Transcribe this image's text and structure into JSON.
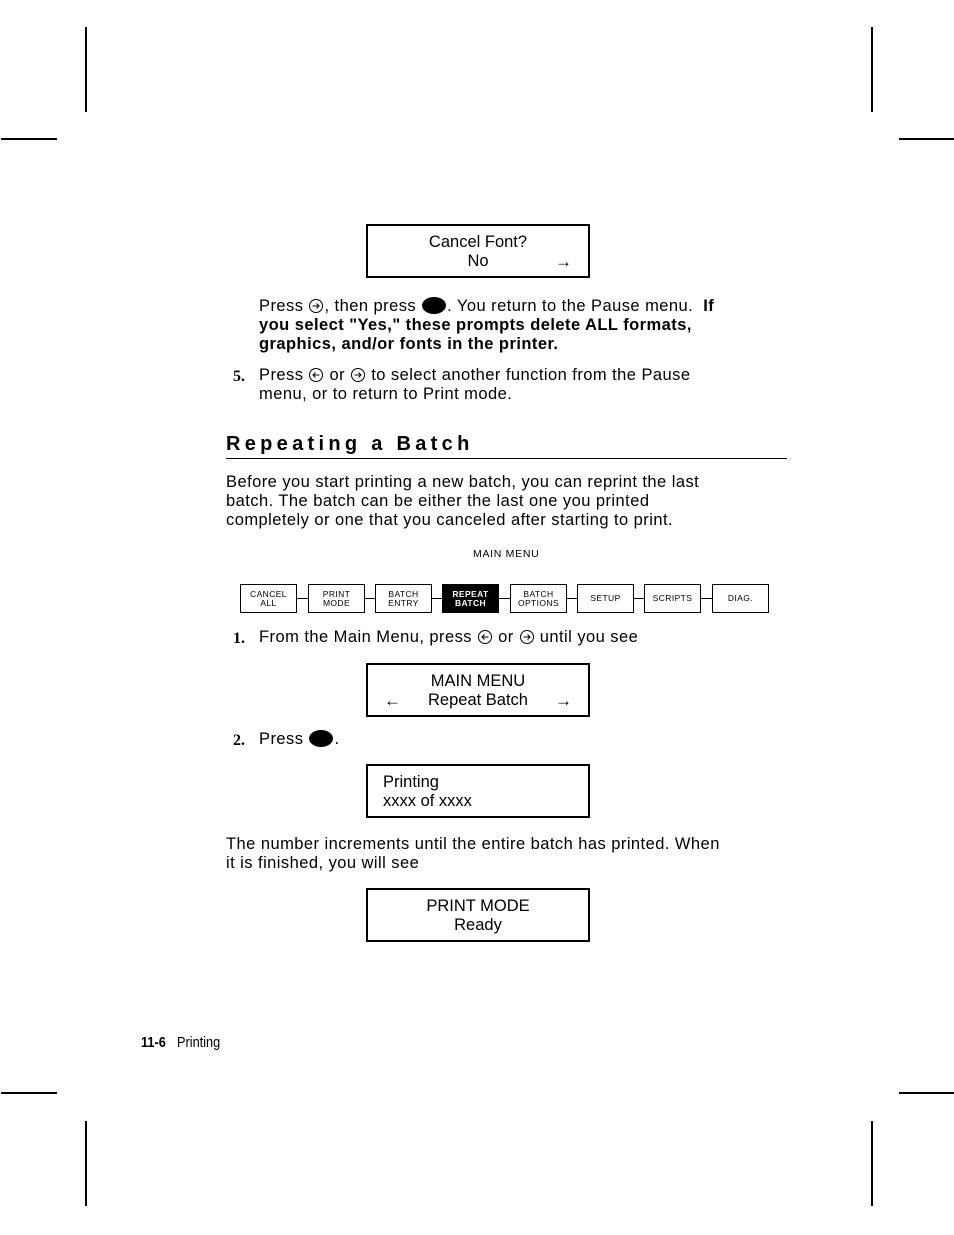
{
  "lcd_cancel_font": {
    "line1": "Cancel Font?",
    "line2": "No",
    "right_arrow": "→"
  },
  "step4_cont": {
    "press": "Press",
    "then_press": ", then press",
    "return_text": ".  You return to the Pause menu.",
    "bold_if": "If",
    "bold_line2": "you select \"Yes,\" these prompts delete ALL formats,",
    "bold_line3": "graphics, and/or fonts in the printer."
  },
  "step5": {
    "number": "5.",
    "press": "Press",
    "or": "or",
    "line1_rest": "to select another function from the Pause",
    "line2": "menu, or to return to Print mode."
  },
  "section": {
    "heading": "Repeating a Batch",
    "intro_lines": [
      "Before you start printing a new batch, you can reprint the last",
      "batch.  The batch can be either the last one you printed",
      "completely or one that you canceled after starting to print."
    ]
  },
  "main_menu": {
    "caption": "MAIN MENU",
    "items": [
      {
        "label": "CANCEL\nALL",
        "active": false
      },
      {
        "label": "PRINT\nMODE",
        "active": false
      },
      {
        "label": "BATCH\nENTRY",
        "active": false
      },
      {
        "label": "REPEAT\nBATCH",
        "active": true
      },
      {
        "label": "BATCH\nOPTIONS",
        "active": false
      },
      {
        "label": "SETUP",
        "active": false
      },
      {
        "label": "SCRIPTS",
        "active": false
      },
      {
        "label": "DIAG.",
        "active": false
      }
    ]
  },
  "step1": {
    "number": "1.",
    "text_a": "From the Main Menu, press",
    "or": "or",
    "text_b": "until you see"
  },
  "lcd_main_menu": {
    "line1": "MAIN MENU",
    "line2": "Repeat Batch",
    "left_arrow": "←",
    "right_arrow": "→"
  },
  "step2": {
    "number": "2.",
    "press": "Press",
    "period": "."
  },
  "lcd_printing": {
    "line1": "Printing",
    "line2": "xxxx of xxxx"
  },
  "after_text": [
    "The number increments until the entire batch has printed.  When",
    "it is finished, you will see"
  ],
  "lcd_print_mode": {
    "line1": "PRINT MODE",
    "line2": "Ready"
  },
  "footer": {
    "page_number": "11-6",
    "section_label": "Printing"
  },
  "icons": {
    "left_key": "left-arrow-key-icon",
    "right_key": "right-arrow-key-icon",
    "enter_key": "enter-key-icon"
  }
}
